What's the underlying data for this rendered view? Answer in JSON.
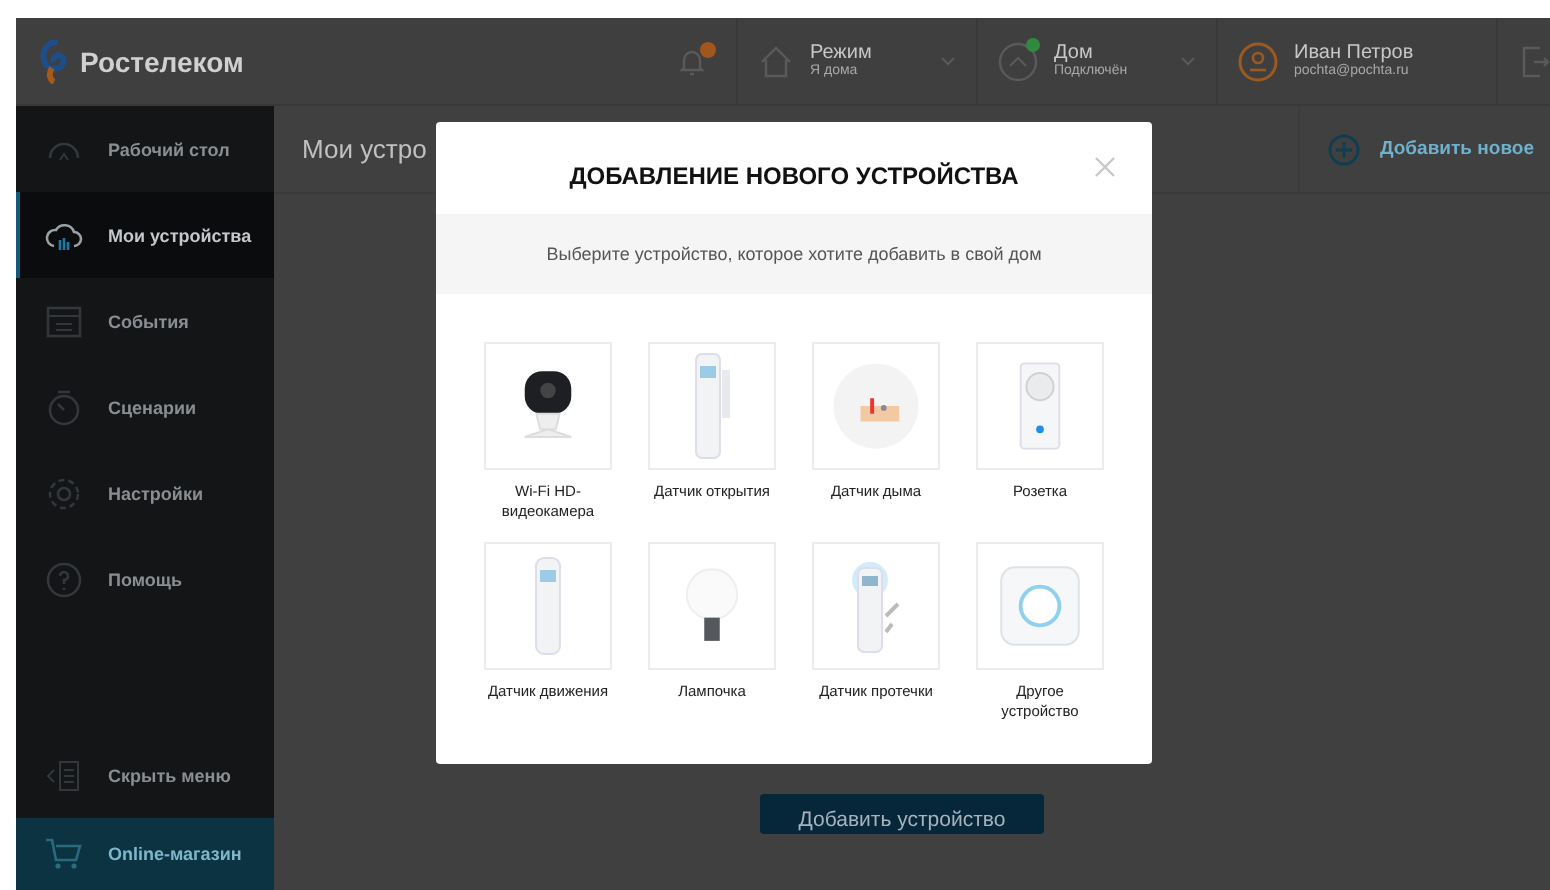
{
  "header": {
    "logo": "Ростелеком",
    "notifications": {
      "badge": true
    },
    "mode": {
      "title": "Режим",
      "value": "Я дома"
    },
    "home": {
      "title": "Дом",
      "status": "Подключён",
      "online": true
    },
    "user": {
      "name": "Иван Петров",
      "email": "pochta@pochta.ru"
    }
  },
  "sidebar": {
    "items": [
      {
        "label": "Рабочий стол",
        "selected": false
      },
      {
        "label": "Мои устройства",
        "selected": true
      },
      {
        "label": "События",
        "selected": false
      },
      {
        "label": "Сценарии",
        "selected": false
      },
      {
        "label": "Настройки",
        "selected": false
      },
      {
        "label": "Помощь",
        "selected": false
      }
    ],
    "hide_menu": "Скрыть меню",
    "shop": "Online-магазин"
  },
  "page": {
    "title": "Мои устро",
    "add_new": "Добавить новое",
    "add_device_button": "Добавить устройство"
  },
  "dialog": {
    "title": "ДОБАВЛЕНИЕ НОВОГО УСТРОЙСТВА",
    "subtitle": "Выберите устройство, которое хотите добавить в свой дом",
    "devices": [
      {
        "label": "Wi-Fi HD-видеокамера",
        "kind": "camera"
      },
      {
        "label": "Датчик открытия",
        "kind": "door"
      },
      {
        "label": "Датчик дыма",
        "kind": "smoke"
      },
      {
        "label": "Розетка",
        "kind": "socket"
      },
      {
        "label": "Датчик движения",
        "kind": "motion"
      },
      {
        "label": "Лампочка",
        "kind": "bulb"
      },
      {
        "label": "Датчик протечки",
        "kind": "leak"
      },
      {
        "label": "Другое устройство",
        "kind": "hub"
      }
    ]
  }
}
